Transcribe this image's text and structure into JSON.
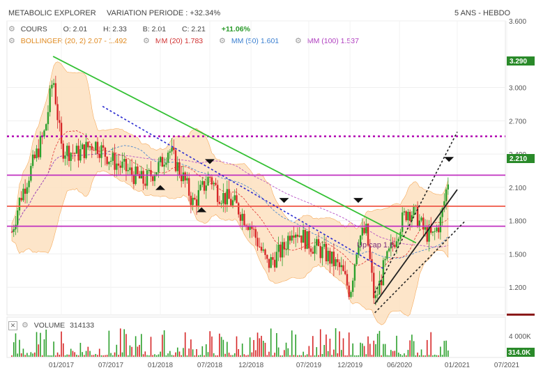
{
  "header": {
    "title": "METABOLIC EXPLORER",
    "variation": "VARIATION PERIODE : +32.34%",
    "period": "5 ANS - HEBDO"
  },
  "legend": {
    "cours": "COURS",
    "o": "O: 2.01",
    "h": "H: 2.33",
    "b": "B: 2.01",
    "c": "C: 2.21",
    "change": "+11.06%",
    "bollinger": "BOLLINGER (20, 2)  2.07 - 1.492",
    "mm20": "MM (20)  1.783",
    "mm50": "MM (50)  1.601",
    "mm100": "MM (100)  1.537"
  },
  "volume": {
    "label": "VOLUME",
    "value": "314133",
    "axis_label": "4 000K",
    "tag": "314.0K"
  },
  "price_tags": {
    "high_tag": "3.290",
    "last_tag": "2.210"
  },
  "annotation": "Up cap 1.6",
  "colors": {
    "up": "#2ca02c",
    "down": "#d62728",
    "bollinger_fill": "#fde3c4",
    "bollinger_line": "#f5a14a",
    "mm20": "#e03030",
    "mm50": "#3a7fd0",
    "mm100": "#b040c0",
    "trend_green": "#33c033",
    "trend_blue": "#2a2ad0",
    "h_magenta": "#c030c0",
    "h_red": "#f06050",
    "tag_green": "#2a8a2a"
  },
  "chart_data": {
    "type": "candlestick",
    "title": "METABOLIC EXPLORER",
    "ylim": [
      0.95,
      3.6
    ],
    "yticks": [
      "3.600",
      "3.000",
      "2.700",
      "2.400",
      "2.100",
      "1.800",
      "1.500",
      "1.200"
    ],
    "ytick_values": [
      3.6,
      3.0,
      2.7,
      2.4,
      2.1,
      1.8,
      1.5,
      1.2
    ],
    "xticks": [
      "01/2017",
      "07/2017",
      "01/2018",
      "07/2018",
      "12/2018",
      "07/2019",
      "12/2019",
      "06/2020",
      "01/2021",
      "07/2021"
    ],
    "xtick_dates": [
      "2017-01",
      "2017-07",
      "2018-01",
      "2018-07",
      "2018-12",
      "2019-07",
      "2019-12",
      "2020-06",
      "2021-01",
      "2021-07"
    ],
    "price_path": [
      [
        "2016-07",
        1.7
      ],
      [
        "2016-08",
        2.0
      ],
      [
        "2016-09",
        2.2
      ],
      [
        "2016-11",
        2.6
      ],
      [
        "2016-12",
        3.1
      ],
      [
        "2017-01",
        2.45
      ],
      [
        "2017-03",
        2.4
      ],
      [
        "2017-05",
        2.5
      ],
      [
        "2017-07",
        2.35
      ],
      [
        "2017-09",
        2.25
      ],
      [
        "2017-11",
        2.15
      ],
      [
        "2018-01",
        2.3
      ],
      [
        "2018-02",
        2.45
      ],
      [
        "2018-04",
        2.15
      ],
      [
        "2018-05",
        1.95
      ],
      [
        "2018-07",
        2.2
      ],
      [
        "2018-08",
        2.05
      ],
      [
        "2018-10",
        1.95
      ],
      [
        "2018-12",
        1.75
      ],
      [
        "2019-02",
        1.4
      ],
      [
        "2019-04",
        1.55
      ],
      [
        "2019-05",
        1.75
      ],
      [
        "2019-07",
        1.6
      ],
      [
        "2019-09",
        1.5
      ],
      [
        "2019-11",
        1.35
      ],
      [
        "2019-12",
        1.15
      ],
      [
        "2020-01",
        1.65
      ],
      [
        "2020-02",
        1.7
      ],
      [
        "2020-03",
        1.05
      ],
      [
        "2020-04",
        1.35
      ],
      [
        "2020-05",
        1.55
      ],
      [
        "2020-06",
        1.75
      ],
      [
        "2020-07",
        1.9
      ],
      [
        "2020-08",
        1.85
      ],
      [
        "2020-09",
        1.7
      ],
      [
        "2020-10",
        1.65
      ],
      [
        "2020-11",
        1.8
      ],
      [
        "2020-12",
        2.21
      ]
    ],
    "last": {
      "open": 2.01,
      "high": 2.33,
      "low": 2.01,
      "close": 2.21,
      "change_pct": 11.06
    },
    "hlines": [
      {
        "value": 2.56,
        "color": "#b000b0",
        "style": "dotted"
      },
      {
        "value": 2.21,
        "color": "#c030c0",
        "style": "solid"
      },
      {
        "value": 1.93,
        "color": "#f06050",
        "style": "solid"
      },
      {
        "value": 1.75,
        "color": "#c030c0",
        "style": "solid"
      }
    ],
    "trendlines": [
      {
        "from": [
          "2016-12",
          3.28
        ],
        "to": [
          "2020-08",
          1.6
        ],
        "color": "#33c033",
        "style": "solid"
      },
      {
        "from": [
          "2017-06",
          2.83
        ],
        "to": [
          "2020-04",
          1.37
        ],
        "color": "#2a2ad0",
        "style": "dashed"
      },
      {
        "from": [
          "2020-03",
          1.05
        ],
        "to": [
          "2021-01",
          2.08
        ],
        "color": "#222222",
        "style": "solid"
      },
      {
        "from": [
          "2020-03",
          1.15
        ],
        "to": [
          "2021-01",
          2.6
        ],
        "color": "#222222",
        "style": "dotted"
      },
      {
        "from": [
          "2020-03",
          0.97
        ],
        "to": [
          "2021-02",
          1.8
        ],
        "color": "#222222",
        "style": "dotted"
      }
    ],
    "volume_ylim": [
      0,
      5500
    ],
    "volume_unit": "K"
  }
}
